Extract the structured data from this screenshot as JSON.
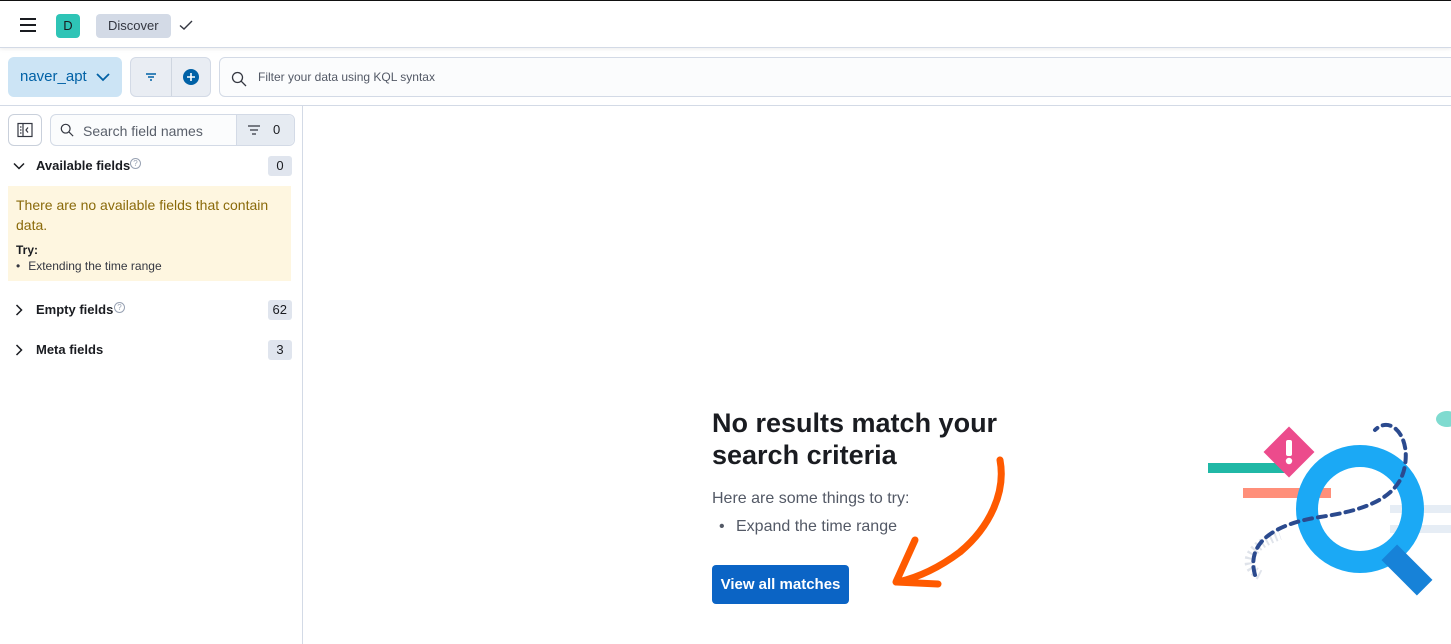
{
  "header": {
    "space_initial": "D",
    "breadcrumb": "Discover"
  },
  "query_bar": {
    "data_view": "naver_apt",
    "kql_placeholder": "Filter your data using KQL syntax"
  },
  "sidebar": {
    "search_placeholder": "Search field names",
    "filter_count": "0",
    "available_fields": {
      "label": "Available fields",
      "count": "0"
    },
    "callout": {
      "message": "There are no available fields that contain data.",
      "try_label": "Try:",
      "tip": "Extending the time range"
    },
    "empty_fields": {
      "label": "Empty fields",
      "count": "62"
    },
    "meta_fields": {
      "label": "Meta fields",
      "count": "3"
    }
  },
  "main": {
    "title": "No results match your search criteria",
    "subtitle": "Here are some things to try:",
    "tip": "Expand the time range",
    "button_label": "View all matches"
  },
  "colors": {
    "primary": "#0b64c5",
    "accent_teal": "#2ec4b6",
    "annotation_arrow": "#ff5a00",
    "warning_bg": "#fef6e0"
  },
  "icons": [
    "menu-icon",
    "check-icon",
    "chevron-down-icon",
    "filter-menu-icon",
    "add-filter-icon",
    "search-icon",
    "sidebar-collapse-icon",
    "chevron-right-icon",
    "question-icon"
  ]
}
